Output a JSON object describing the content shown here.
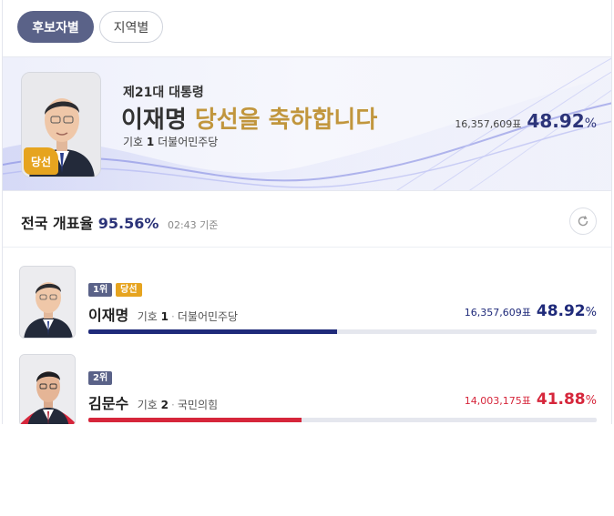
{
  "tabs": [
    {
      "label": "후보자별",
      "active": true
    },
    {
      "label": "지역별",
      "active": false
    }
  ],
  "winner": {
    "subtitle": "제21대 대통령",
    "name": "이재명",
    "congrats": "당선을 축하합니다",
    "number_label": "기호",
    "number": "1",
    "party": "더불어민주당",
    "votes": "16,357,609표",
    "percent": "48.92",
    "percent_sign": "%",
    "badge": "당선"
  },
  "counting": {
    "label": "전국 개표율",
    "percent": "95.56%",
    "time": "02:43 기준"
  },
  "candidates": [
    {
      "rank": "1위",
      "won": "당선",
      "name": "이재명",
      "number_label": "기호",
      "number": "1",
      "party": "더불어민주당",
      "votes": "16,357,609표",
      "percent": "48.92",
      "percent_sign": "%",
      "color": "#1f2a7a",
      "share": 0.4892
    },
    {
      "rank": "2위",
      "name": "김문수",
      "number_label": "기호",
      "number": "2",
      "party": "국민의힘",
      "votes": "14,003,175표",
      "percent": "41.88",
      "percent_sign": "%",
      "color": "#d6263b",
      "share": 0.4188
    }
  ],
  "colors": {
    "accent_navy": "#2c3479",
    "gold": "#c1963d",
    "badge_gold": "#e6a41f",
    "tab_active": "#5a6288"
  },
  "icons": {
    "refresh": "refresh-icon"
  }
}
